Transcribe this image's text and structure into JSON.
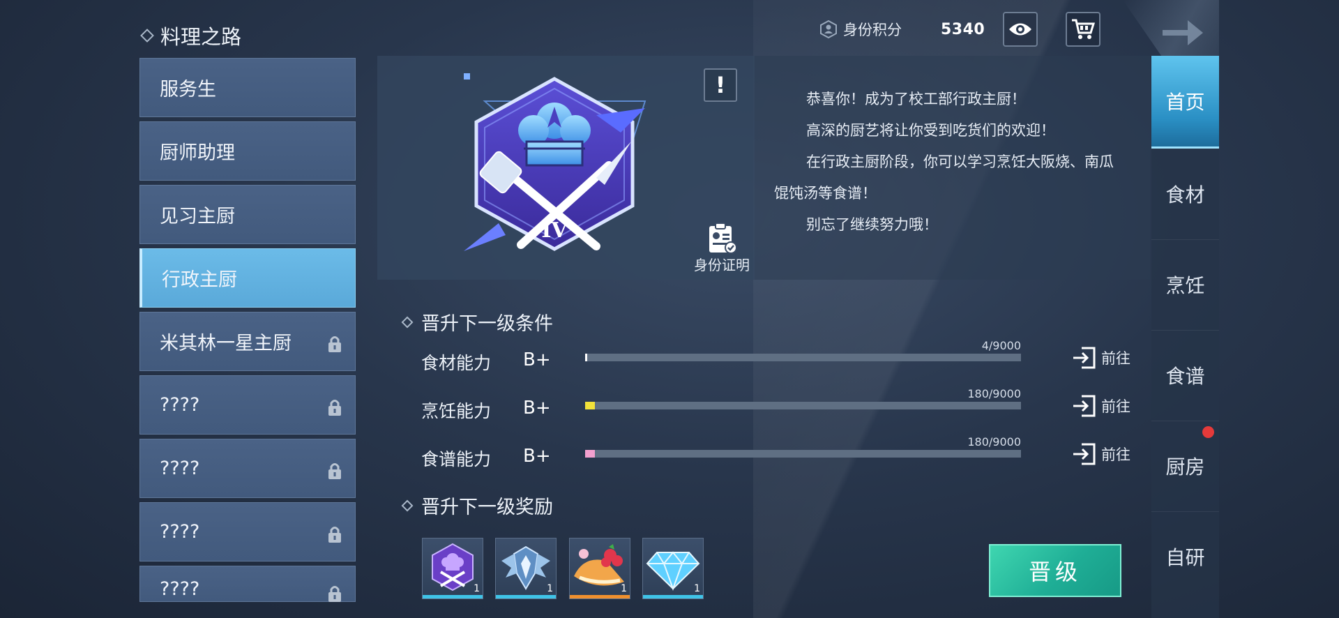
{
  "header": {
    "title": "料理之路",
    "identity_points_label": "身份积分",
    "identity_points_value": "5340"
  },
  "ranks": [
    {
      "label": "服务生",
      "locked": false
    },
    {
      "label": "厨师助理",
      "locked": false
    },
    {
      "label": "见习主厨",
      "locked": false
    },
    {
      "label": "行政主厨",
      "locked": false,
      "active": true
    },
    {
      "label": "米其林一星主厨",
      "locked": true
    },
    {
      "label": "????",
      "locked": true
    },
    {
      "label": "????",
      "locked": true
    },
    {
      "label": "????",
      "locked": true
    },
    {
      "label": "????",
      "locked": true
    }
  ],
  "badge": {
    "tier": "IV"
  },
  "notice": {
    "symbol": "!"
  },
  "id_proof_label": "身份证明",
  "description": [
    "恭喜你！成为了校工部行政主厨！",
    "高深的厨艺将让你受到吃货们的欢迎！",
    "在行政主厨阶段，你可以学习烹饪大阪烧、南瓜",
    "馄饨汤等食谱！",
    "别忘了继续努力哦！"
  ],
  "requirements_title": "晋升下一级条件",
  "requirements": [
    {
      "name": "食材能力",
      "grade": "B+",
      "count": "4/9000",
      "current": 4,
      "max": 9000,
      "color": "#ffffff",
      "go": "前往"
    },
    {
      "name": "烹饪能力",
      "grade": "B+",
      "count": "180/9000",
      "current": 180,
      "max": 9000,
      "color": "#f2e23a",
      "go": "前往"
    },
    {
      "name": "食谱能力",
      "grade": "B+",
      "count": "180/9000",
      "current": 180,
      "max": 9000,
      "color": "#f3a0cf",
      "go": "前往"
    }
  ],
  "rewards_title": "晋升下一级奖励",
  "rewards": [
    {
      "icon": "chef-badge-icon",
      "qty": "1",
      "rarity_color": "#3fc4e8"
    },
    {
      "icon": "crystal-wings-icon",
      "qty": "1",
      "rarity_color": "#3fc4e8"
    },
    {
      "icon": "dessert-icon",
      "qty": "1",
      "rarity_color": "#f0902e"
    },
    {
      "icon": "diamond-icon",
      "qty": "1",
      "rarity_color": "#3fc4e8"
    }
  ],
  "promote_label": "晋级",
  "nav": [
    {
      "label": "首页",
      "active": true
    },
    {
      "label": "食材"
    },
    {
      "label": "烹饪"
    },
    {
      "label": "食谱"
    },
    {
      "label": "厨房",
      "dot": true
    },
    {
      "label": "自研"
    }
  ],
  "colors": {
    "accent": "#5fc4ee",
    "promote": "#1fae96",
    "active_rank": "#6bbbe8"
  }
}
